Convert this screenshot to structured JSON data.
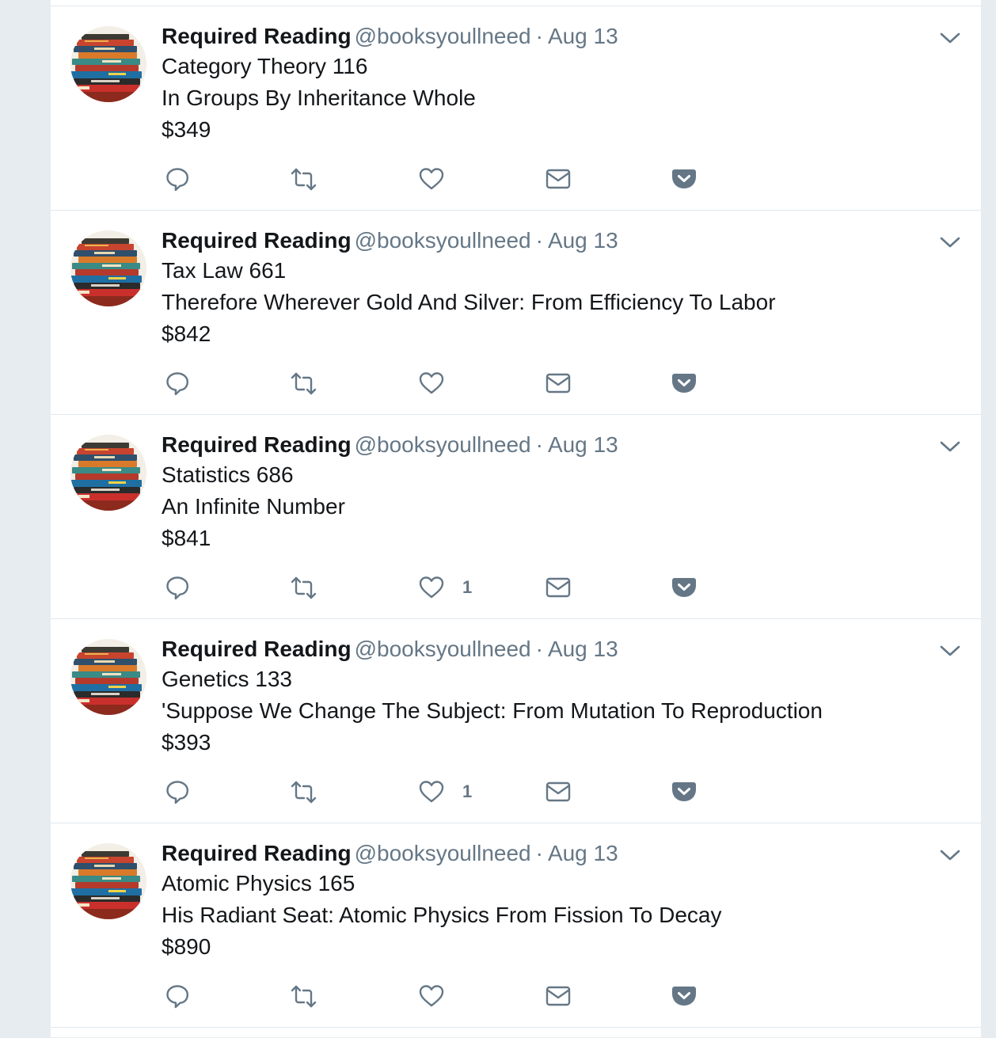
{
  "tweets": [
    {
      "author_name": "Required Reading",
      "handle": "@booksyoullneed",
      "separator": "·",
      "date": "Aug 13",
      "course": "Category Theory 116",
      "title": "In Groups By Inheritance Whole",
      "price": "$349",
      "like_count": ""
    },
    {
      "author_name": "Required Reading",
      "handle": "@booksyoullneed",
      "separator": "·",
      "date": "Aug 13",
      "course": "Tax Law 661",
      "title": "Therefore Wherever Gold And Silver: From Efficiency To Labor",
      "price": "$842",
      "like_count": ""
    },
    {
      "author_name": "Required Reading",
      "handle": "@booksyoullneed",
      "separator": "·",
      "date": "Aug 13",
      "course": "Statistics 686",
      "title": "An Infinite Number",
      "price": "$841",
      "like_count": "1"
    },
    {
      "author_name": "Required Reading",
      "handle": "@booksyoullneed",
      "separator": "·",
      "date": "Aug 13",
      "course": "Genetics 133",
      "title": "'Suppose We Change The Subject: From Mutation To Reproduction",
      "price": "$393",
      "like_count": "1"
    },
    {
      "author_name": "Required Reading",
      "handle": "@booksyoullneed",
      "separator": "·",
      "date": "Aug 13",
      "course": "Atomic Physics 165",
      "title": "His Radiant Seat: Atomic Physics From Fission To Decay",
      "price": "$890",
      "like_count": ""
    }
  ],
  "icons": {
    "reply": "reply-icon",
    "retweet": "retweet-icon",
    "like": "heart-icon",
    "dm": "envelope-icon",
    "pocket": "pocket-icon",
    "caret": "chevron-down-icon"
  },
  "colors": {
    "background": "#e6ecf0",
    "card": "#ffffff",
    "text": "#14171a",
    "muted": "#657786",
    "border": "#e1e8ed"
  }
}
